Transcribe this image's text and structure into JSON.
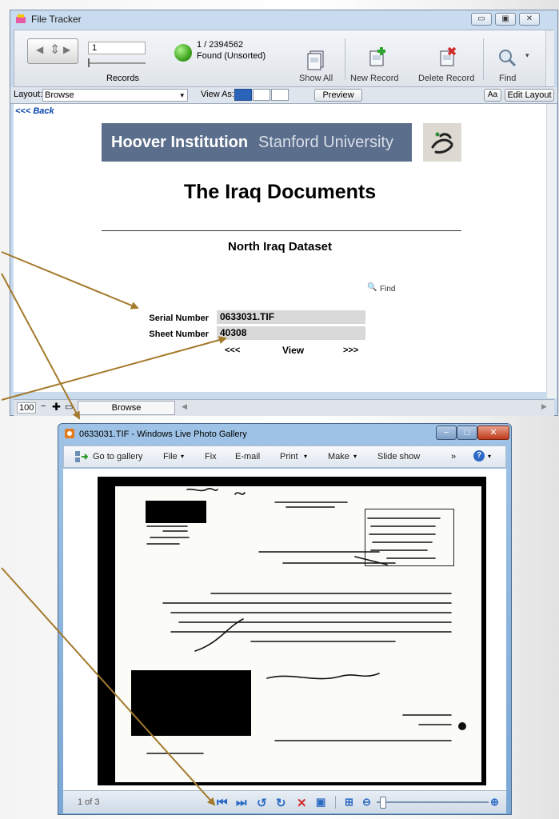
{
  "filetracker": {
    "title": "File Tracker",
    "record_field": "1",
    "records_label": "Records",
    "found_count": "1 / 2394562",
    "found_status": "Found (Unsorted)",
    "toolbar": {
      "show_all": "Show All",
      "new_record": "New Record",
      "delete_record": "Delete Record",
      "find": "Find"
    },
    "layout_label": "Layout:",
    "layout_value": "Browse",
    "view_as_label": "View As:",
    "preview": "Preview",
    "aa": "Aa",
    "edit_layout": "Edit Layout",
    "back_link": "<<< Back",
    "banner_bold": "Hoover Institution",
    "banner_light": "Stanford University",
    "heading": "The Iraq Documents",
    "subheading": "North Iraq Dataset",
    "find_link": "Find",
    "serial_label": "Serial Number",
    "serial_value": "0633031.TIF",
    "sheet_label": "Sheet Number",
    "sheet_value": "40308",
    "prev": "<<<",
    "view": "View",
    "next": ">>>",
    "zoom": "100",
    "mode": "Browse"
  },
  "gallery": {
    "title": "0633031.TIF - Windows Live Photo Gallery",
    "menu": {
      "go_to_gallery": "Go to gallery",
      "file": "File",
      "fix": "Fix",
      "email": "E-mail",
      "print": "Print",
      "make": "Make",
      "slide_show": "Slide show",
      "more": "»"
    },
    "page_counter": "1 of 3"
  },
  "colors": {
    "window_frame": "#c9dcef",
    "banner": "#5b6e8b",
    "arrow": "#a47a2c",
    "link_blue": "#0645ad"
  }
}
